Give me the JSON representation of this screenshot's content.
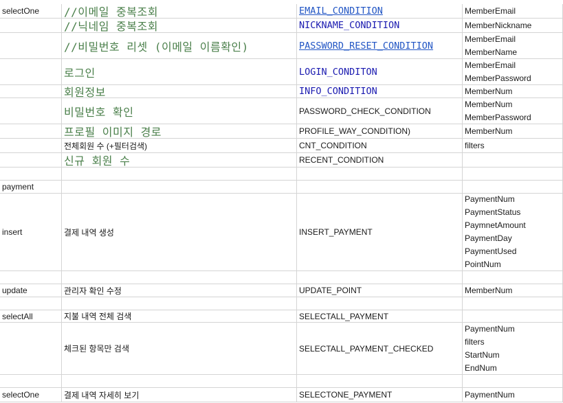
{
  "rows": [
    {
      "a": "selectOne",
      "b": "//이메일 중복조회",
      "b_style": "green",
      "c": "EMAIL_CONDITION",
      "c_style": "link",
      "d": [
        "MemberEmail"
      ]
    },
    {
      "a": "",
      "b": "//닉네임 중복조회",
      "b_style": "green",
      "c": "NICKNAME_CONDITION",
      "c_style": "navy",
      "d": [
        "MemberNickname"
      ]
    },
    {
      "a": "",
      "b": "//비밀번호 리셋 (이메일 이름확인)",
      "b_style": "green",
      "c": "PASSWORD_RESET_CONDITION",
      "c_style": "link",
      "d": [
        "MemberEmail",
        "MemberName"
      ]
    },
    {
      "a": "",
      "b": "로그인",
      "b_style": "green",
      "c": "LOGIN_CONDITON",
      "c_style": "navy",
      "d": [
        "MemberEmail",
        "MemberPassword"
      ]
    },
    {
      "a": "",
      "b": "회원정보",
      "b_style": "green",
      "c": "INFO_CONDITION",
      "c_style": "navy",
      "d": [
        "MemberNum"
      ]
    },
    {
      "a": "",
      "b": "비밀번호 확인",
      "b_style": "green",
      "c": "PASSWORD_CHECK_CONDITION",
      "c_style": "",
      "d": [
        "MemberNum",
        "MemberPassword"
      ]
    },
    {
      "a": "",
      "b": "프로필 이미지 경로",
      "b_style": "green",
      "c": "PROFILE_WAY_CONDITION)",
      "c_style": "",
      "d": [
        "MemberNum"
      ]
    },
    {
      "a": "",
      "b": "전체회원 수 (+필터검색)",
      "b_style": "",
      "c": "CNT_CONDITION",
      "c_style": "",
      "d": [
        "filters"
      ]
    },
    {
      "a": "",
      "b": "신규 회원 수",
      "b_style": "green",
      "c": "RECENT_CONDITION",
      "c_style": "",
      "d": []
    },
    {
      "a": "",
      "b": "",
      "b_style": "",
      "c": "",
      "c_style": "",
      "d": []
    },
    {
      "a": "payment",
      "b": "",
      "b_style": "",
      "c": "",
      "c_style": "",
      "d": []
    },
    {
      "a": "insert",
      "b": "결제 내역 생성",
      "b_style": "",
      "c": "INSERT_PAYMENT",
      "c_style": "",
      "d": [
        "PaymentNum",
        "PaymentStatus",
        "PaymnetAmount",
        "PaymentDay",
        "PaymentUsed",
        "PointNum"
      ]
    },
    {
      "a": "",
      "b": "",
      "b_style": "",
      "c": "",
      "c_style": "",
      "d": []
    },
    {
      "a": "update",
      "b": "관리자 확인 수정",
      "b_style": "",
      "c": "UPDATE_POINT",
      "c_style": "",
      "d": [
        "MemberNum"
      ]
    },
    {
      "a": "",
      "b": "",
      "b_style": "",
      "c": "",
      "c_style": "",
      "d": []
    },
    {
      "a": "selectAll",
      "b": "지불 내역 전체 검색",
      "b_style": "",
      "c": "SELECTALL_PAYMENT",
      "c_style": "",
      "d": []
    },
    {
      "a": "",
      "b": "체크된 항목만 검색",
      "b_style": "",
      "c": "SELECTALL_PAYMENT_CHECKED",
      "c_style": "",
      "d": [
        "PaymentNum",
        "filters",
        "StartNum",
        "EndNum"
      ]
    },
    {
      "a": "",
      "b": "",
      "b_style": "",
      "c": "",
      "c_style": "",
      "d": []
    },
    {
      "a": "selectOne",
      "b": "결제 내역 자세히 보기",
      "b_style": "",
      "c": "SELECTONE_PAYMENT",
      "c_style": "",
      "d": [
        "PaymentNum"
      ]
    }
  ]
}
